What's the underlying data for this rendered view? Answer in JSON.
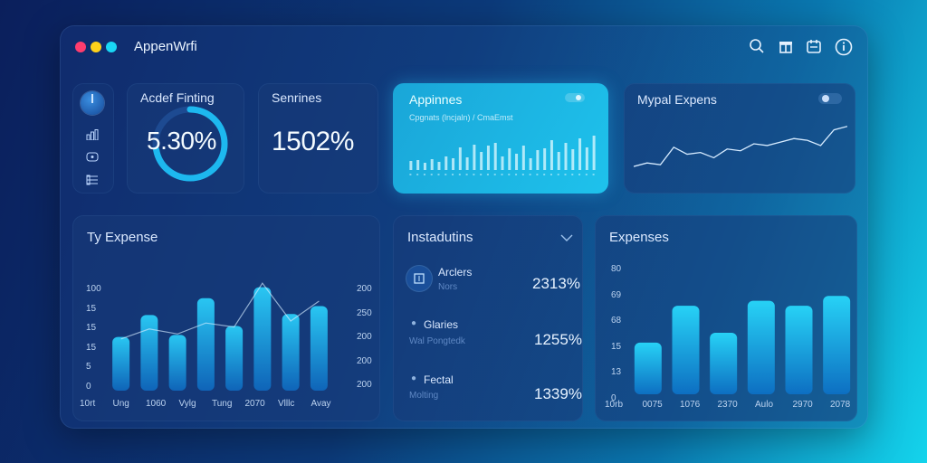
{
  "app": {
    "title": "AppenWrfi"
  },
  "window_dots": [
    "#ff3d6e",
    "#ffd11a",
    "#19d7f5"
  ],
  "toolbar_icons": [
    "search-icon",
    "gift-icon",
    "calendar-icon",
    "info-icon"
  ],
  "sidebar_icons": [
    "chart-icon",
    "message-icon",
    "list-icon"
  ],
  "cards": {
    "finting": {
      "title": "Acdef Finting",
      "value": "5.30%",
      "ring_fraction": 0.72
    },
    "senrines": {
      "title": "Senrines",
      "value": "1502%"
    },
    "appinnes": {
      "title": "Appinnes",
      "subtitle": "Cpgnats (lncjaln) / CmaEmst"
    },
    "mypal": {
      "title": "Mypal Expens"
    },
    "expense_left": {
      "title": "Ty Expense",
      "y_left": [
        "100",
        "15",
        "15",
        "15",
        "5",
        "0"
      ],
      "y_right": [
        "200",
        "250",
        "200",
        "200",
        "200"
      ],
      "x": [
        "10rt",
        "Ung",
        "1060",
        "Vylg",
        "Tung",
        "2070",
        "Vlllc",
        "Avay"
      ]
    },
    "instadutins": {
      "title": "Instadutins",
      "rows": [
        {
          "label": "Arclers",
          "sub": "Nors",
          "value": "2313%"
        },
        {
          "label": "Glaries",
          "sub": "Wal Pongtedk",
          "value": "1255%"
        },
        {
          "label": "Fectal",
          "sub": "Molting",
          "value": "1339%"
        }
      ]
    },
    "expenses_right": {
      "title": "Expenses",
      "y": [
        "80",
        "69",
        "68",
        "15",
        "13",
        "0"
      ],
      "x": [
        "10rb",
        "0075",
        "1076",
        "2370",
        "Aulo",
        "2970",
        "2078"
      ]
    }
  },
  "chart_data": [
    {
      "type": "bar",
      "title": "Ty Expense",
      "categories": [
        "Ung",
        "1060",
        "Vylg",
        "Tung",
        "2070",
        "Vlllc",
        "Avay"
      ],
      "series": [
        {
          "values": [
            54,
            76,
            56,
            93,
            65,
            104,
            77,
            85
          ]
        },
        {
          "type": "line",
          "values": [
            52,
            62,
            57,
            68,
            64,
            108,
            70,
            90
          ]
        }
      ],
      "ylim": [
        0,
        120
      ]
    },
    {
      "type": "bar",
      "title": "Expenses",
      "categories": [
        "0075",
        "1076",
        "2370",
        "Aulo",
        "2970",
        "2078"
      ],
      "values": [
        42,
        72,
        50,
        76,
        72,
        80
      ],
      "ylim": [
        0,
        100
      ]
    },
    {
      "type": "bar",
      "title": "Appinnes",
      "values": [
        10,
        11,
        8,
        12,
        9,
        15,
        13,
        25,
        14,
        28,
        20,
        27,
        30,
        15,
        24,
        18,
        27,
        13,
        22,
        24,
        33,
        20,
        30,
        23,
        35,
        25,
        38
      ],
      "ylim": [
        0,
        40
      ]
    },
    {
      "type": "line",
      "title": "Mypal Expens",
      "values": [
        1,
        3,
        2,
        12,
        8,
        9,
        6,
        11,
        10,
        14,
        13,
        15,
        17,
        16,
        13,
        22,
        24
      ],
      "ylim": [
        0,
        28
      ]
    }
  ]
}
